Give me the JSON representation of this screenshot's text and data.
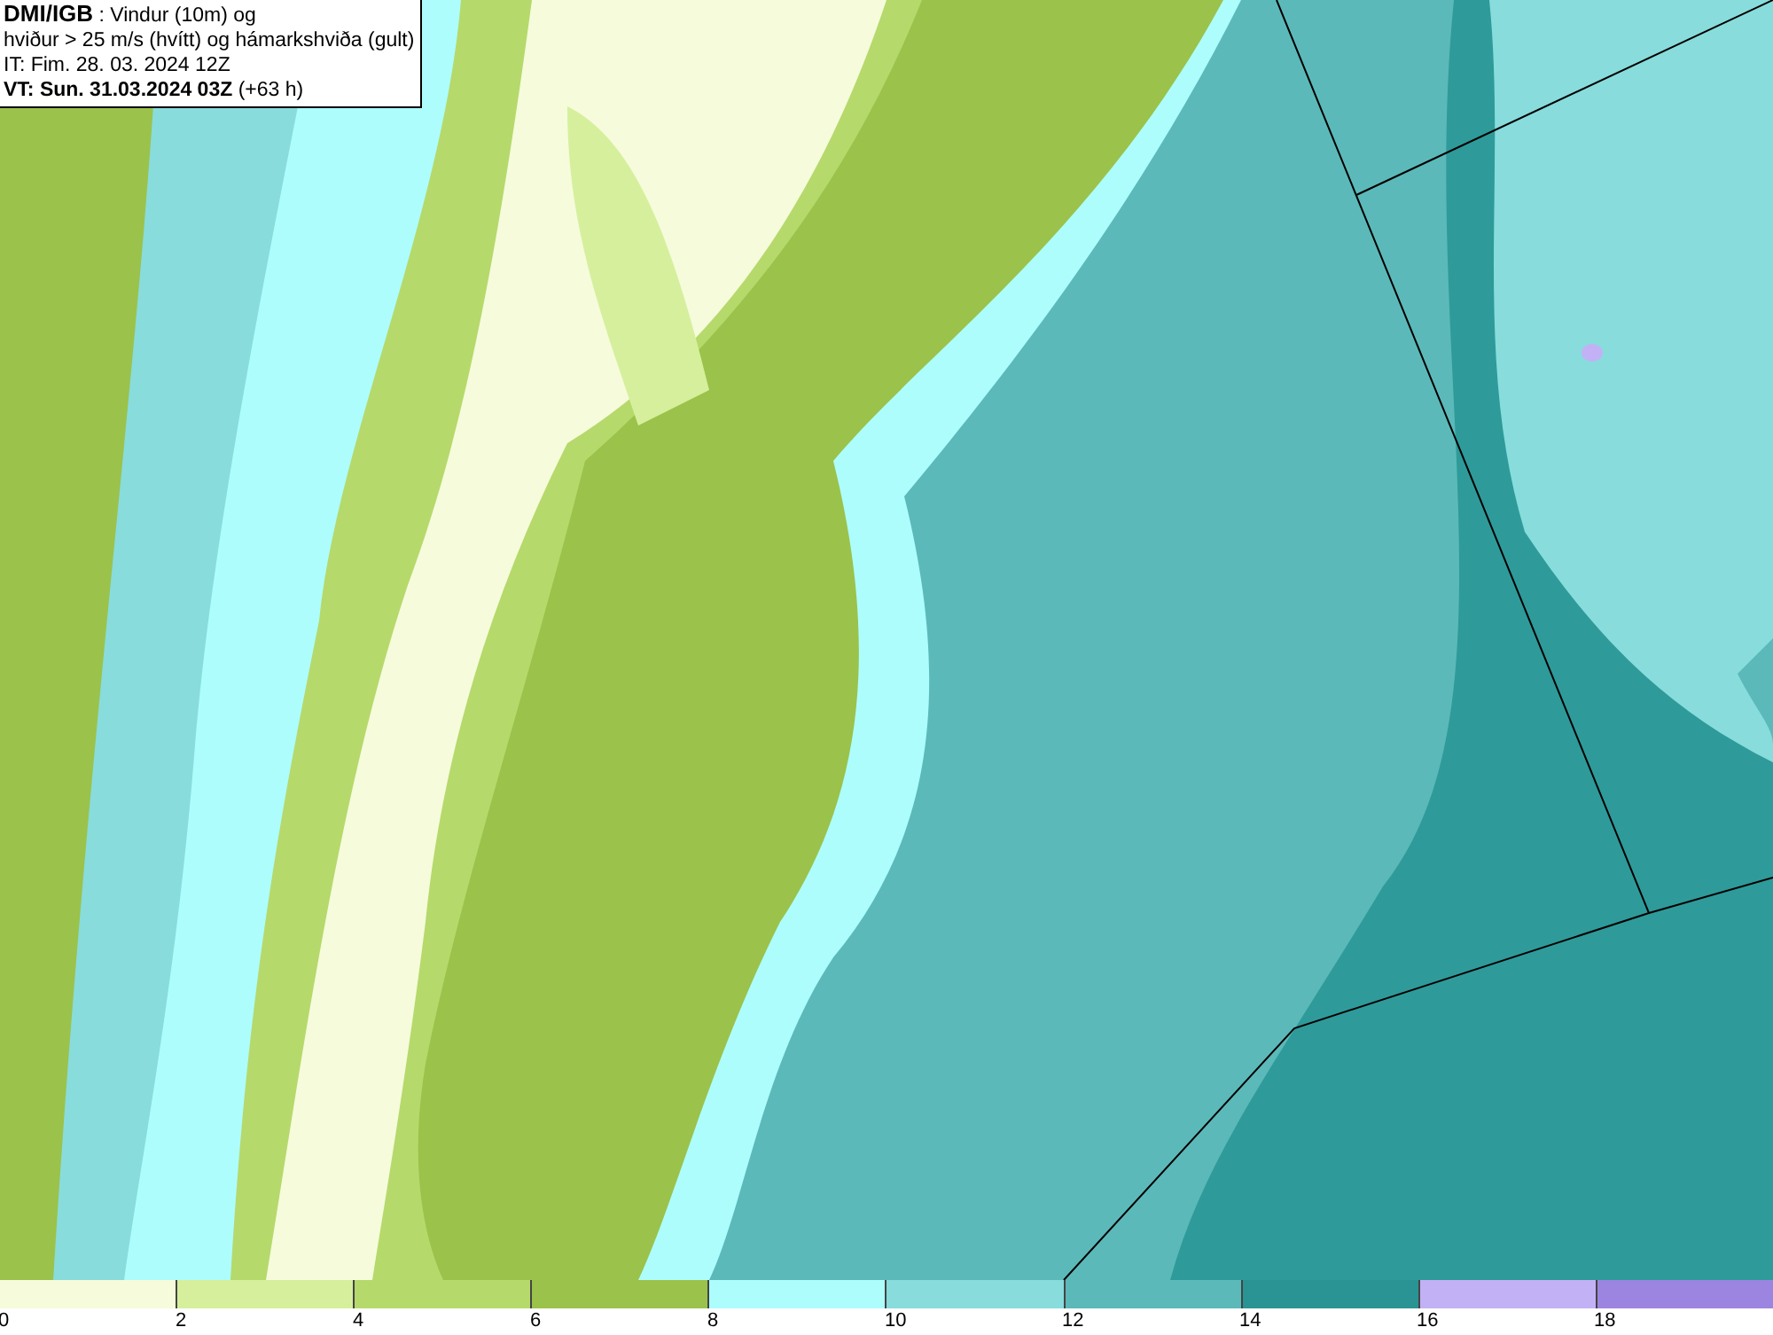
{
  "header": {
    "lines": [
      "**DMI/IGB** : Vindur (10m) og",
      "hviður > 25 m/s (hvítt) og hámarkshviða (gult)",
      "IT: Fim. 28. 03. 2024 12Z",
      "**VT: Sun. 31.03.2024 03Z** (+63 h)"
    ]
  },
  "legend": [
    {
      "label": "0",
      "color": "#f5fbdb"
    },
    {
      "label": "2",
      "color": "#d6ef9c"
    },
    {
      "label": "4",
      "color": "#b6d96b"
    },
    {
      "label": "6",
      "color": "#9bc24a"
    },
    {
      "label": "8",
      "color": "#adfdfd"
    },
    {
      "label": "10",
      "color": "#88dcdc"
    },
    {
      "label": "12",
      "color": "#5cb9b9"
    },
    {
      "label": "14",
      "color": "#2a9494"
    },
    {
      "label": "16",
      "color": "#c3b1f6"
    },
    {
      "label": "18",
      "color": "#9c85e0"
    }
  ]
}
